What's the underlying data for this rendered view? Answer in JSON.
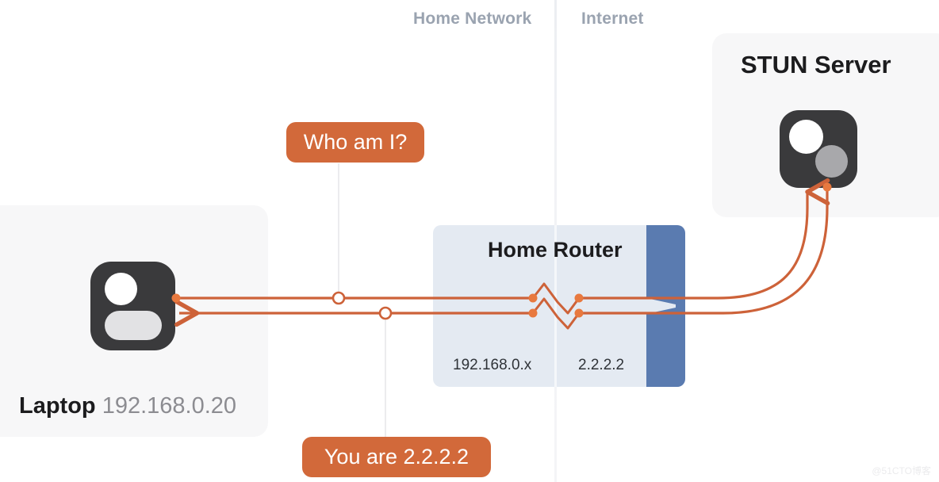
{
  "zones": {
    "home_label": "Home Network",
    "internet_label": "Internet"
  },
  "laptop": {
    "name": "Laptop",
    "ip": "192.168.0.20",
    "icon": "person-device-icon"
  },
  "router": {
    "title": "Home Router",
    "lan_ip": "192.168.0.x",
    "wan_ip": "2.2.2.2",
    "nat_symbol": "nat-zigzag-icon",
    "firewall": "firewall-bar"
  },
  "stun": {
    "title": "STUN Server",
    "icon": "server-dots-icon"
  },
  "badges": {
    "question": "Who am I?",
    "answer": "You are 2.2.2.2"
  },
  "watermark": "@51CTO博客",
  "colors": {
    "accent": "#cd6239",
    "badge": "#d2693a",
    "router_panel": "#e4eaf2",
    "firewall_blue": "#5a7bb0",
    "card": "#f7f7f8",
    "device_dark": "#3a3a3c",
    "zone_text": "#9aa3b0"
  }
}
